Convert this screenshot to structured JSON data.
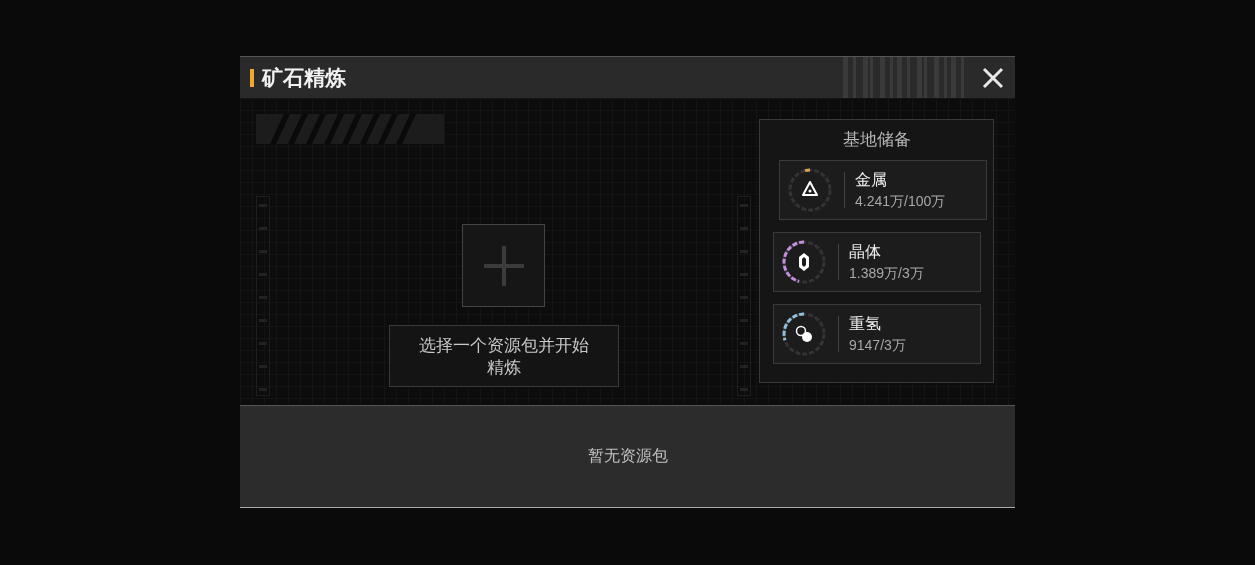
{
  "dialog": {
    "title": "矿石精炼",
    "slot_hint": "选择一个资源包并开始精炼",
    "empty_message": "暂无资源包"
  },
  "base_reserve": {
    "title": "基地储备",
    "resources": [
      {
        "kind": "metal",
        "name": "金属",
        "amount": "4.241万/100万",
        "color": "#e0a050"
      },
      {
        "kind": "crystal",
        "name": "晶体",
        "amount": "1.389万/3万",
        "color": "#c58ee0"
      },
      {
        "kind": "deuterium",
        "name": "重氢",
        "amount": "9147/3万",
        "color": "#8fc0dc"
      }
    ]
  }
}
